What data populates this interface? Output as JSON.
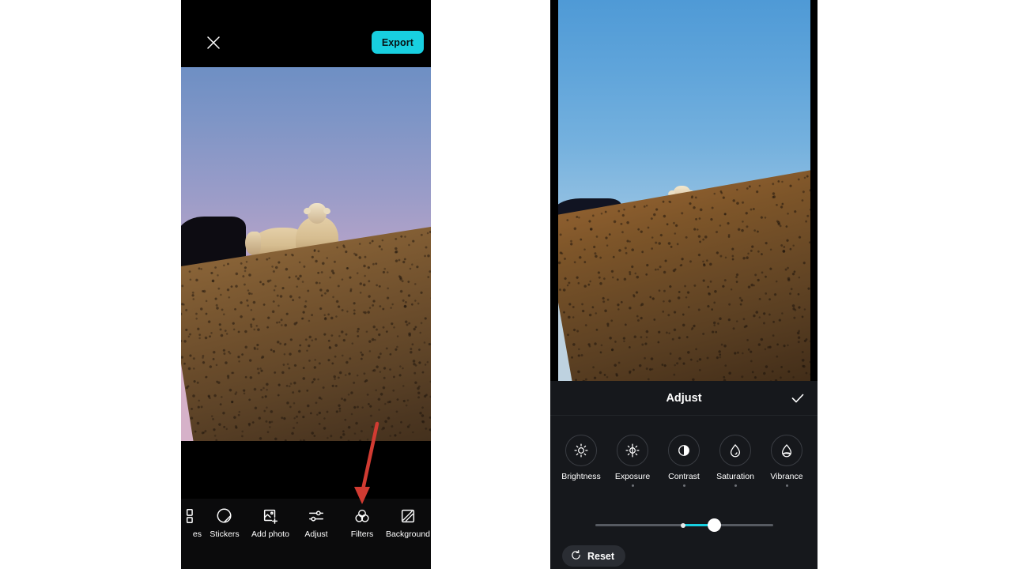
{
  "left_panel": {
    "topbar": {
      "close_icon": "close-icon",
      "export_label": "Export"
    },
    "photo": {
      "alt": "Two sheep standing on a grassy hillside at dusk with a lavender-pink sky"
    },
    "toolbar": {
      "items": [
        {
          "label": "es",
          "icon": "templates-icon",
          "clipped": true
        },
        {
          "label": "Stickers",
          "icon": "sticker-icon",
          "clipped": false
        },
        {
          "label": "Add photo",
          "icon": "add-photo-icon",
          "clipped": false
        },
        {
          "label": "Adjust",
          "icon": "sliders-icon",
          "clipped": false
        },
        {
          "label": "Filters",
          "icon": "filters-icon",
          "clipped": false
        },
        {
          "label": "Background",
          "icon": "background-icon",
          "clipped": false
        }
      ]
    },
    "annotation": {
      "type": "arrow",
      "color": "#d13b32",
      "points_to": "Filters"
    }
  },
  "right_panel": {
    "photo": {
      "alt": "Two sheep standing on a grassy hillside with a vivid blue sky"
    },
    "sheet": {
      "title": "Adjust",
      "done_icon": "check-icon",
      "tools": [
        {
          "label": "Brightness",
          "icon": "brightness-icon",
          "has_dot": false
        },
        {
          "label": "Exposure",
          "icon": "exposure-icon",
          "has_dot": true
        },
        {
          "label": "Contrast",
          "icon": "contrast-icon",
          "has_dot": true
        },
        {
          "label": "Saturation",
          "icon": "saturation-icon",
          "has_dot": true
        },
        {
          "label": "Vibrance",
          "icon": "vibrance-icon",
          "has_dot": true
        }
      ],
      "slider": {
        "center_percent": 49.5,
        "thumb_percent": 67,
        "accent_color": "#18cfe0"
      },
      "reset_label": "Reset",
      "reset_icon": "reset-icon"
    }
  },
  "colors": {
    "accent": "#18cfe0",
    "sheet_bg": "#16181c",
    "panel_bg": "#000000",
    "gutter": "#ffffff",
    "annotation_red": "#d13b32"
  }
}
